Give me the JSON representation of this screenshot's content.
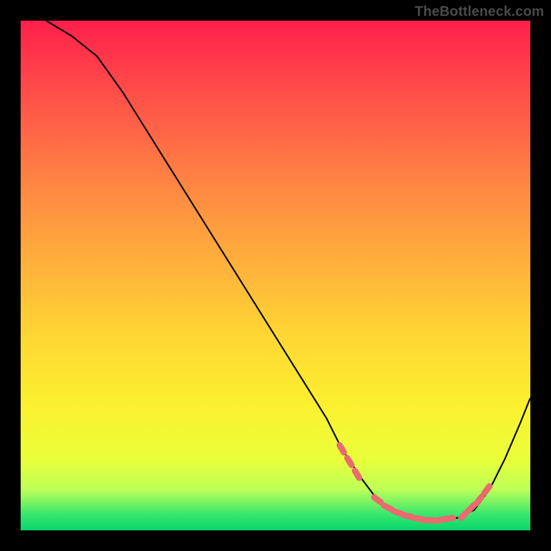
{
  "watermark": "TheBottleneck.com",
  "colors": {
    "background": "#000000",
    "curve": "#000000",
    "dot_fill": "#e96a6f",
    "dot_stroke": "#e96a6f",
    "gradient_stops": [
      "#ff1f4b",
      "#ff3a4a",
      "#ff6048",
      "#ff8b42",
      "#ffb13c",
      "#ffd733",
      "#fbf12f",
      "#eaff3a",
      "#bdff58",
      "#35e66e",
      "#08d66a"
    ]
  },
  "chart_data": {
    "type": "line",
    "title": "",
    "xlabel": "",
    "ylabel": "",
    "xlim": [
      0,
      100
    ],
    "ylim": [
      0,
      100
    ],
    "curve": {
      "x": [
        5,
        10,
        15,
        20,
        25,
        30,
        35,
        40,
        45,
        50,
        55,
        60,
        63,
        67,
        70,
        73,
        76,
        80,
        83,
        86,
        89,
        92,
        95,
        98,
        100
      ],
      "y": [
        100,
        97,
        93,
        86,
        78,
        70,
        62,
        54,
        46,
        38,
        30,
        22,
        16,
        10,
        6,
        4,
        2.5,
        2,
        2,
        2.5,
        4,
        8,
        14,
        21,
        26
      ]
    },
    "marked_segments": [
      {
        "x": [
          63,
          64.5,
          66
        ],
        "y": [
          16,
          13.5,
          11
        ]
      },
      {
        "x": [
          70,
          72,
          74,
          76,
          78,
          80,
          82,
          84
        ],
        "y": [
          6,
          4.5,
          3.5,
          2.8,
          2.3,
          2,
          2,
          2.3
        ]
      },
      {
        "x": [
          87,
          88.5,
          90,
          91.5
        ],
        "y": [
          3,
          4.5,
          6,
          8
        ]
      }
    ]
  }
}
